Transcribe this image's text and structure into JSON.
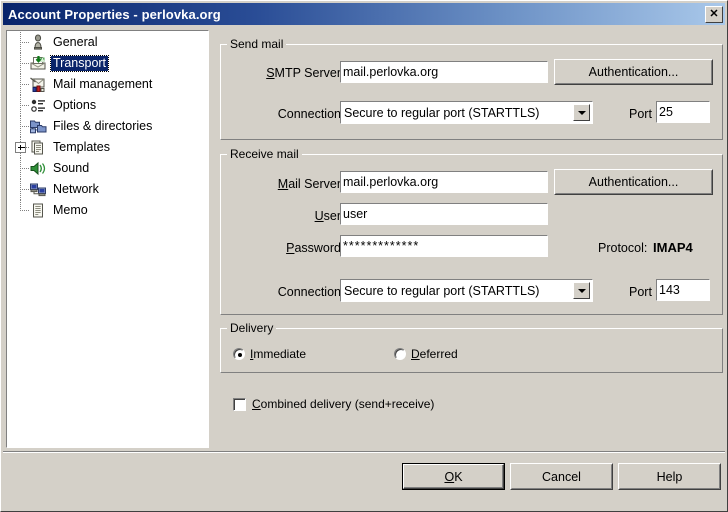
{
  "window": {
    "title": "Account Properties - perlovka.org",
    "close_label": "✕",
    "colors": {
      "face": "#d4d0c8",
      "title_left": "#08246b",
      "title_right": "#a9c8ea",
      "selection": "#0a246a"
    }
  },
  "sidebar": {
    "items": [
      {
        "label": "General",
        "icon": "person-icon",
        "selected": false,
        "expander": false
      },
      {
        "label": "Transport",
        "icon": "inbox-download-icon",
        "selected": true,
        "expander": false
      },
      {
        "label": "Mail management",
        "icon": "mail-tools-icon",
        "selected": false,
        "expander": false
      },
      {
        "label": "Options",
        "icon": "options-list-icon",
        "selected": false,
        "expander": false
      },
      {
        "label": "Files & directories",
        "icon": "folders-icon",
        "selected": false,
        "expander": false
      },
      {
        "label": "Templates",
        "icon": "documents-icon",
        "selected": false,
        "expander": true
      },
      {
        "label": "Sound",
        "icon": "speaker-icon",
        "selected": false,
        "expander": false
      },
      {
        "label": "Network",
        "icon": "network-computers-icon",
        "selected": false,
        "expander": false
      },
      {
        "label": "Memo",
        "icon": "note-icon",
        "selected": false,
        "expander": false
      }
    ]
  },
  "send_mail": {
    "group_title": "Send mail",
    "smtp_label_accel": "S",
    "smtp_label_rest": "MTP Server",
    "smtp_value": "mail.perlovka.org",
    "auth_button": "Authentication...",
    "connection_label": "Connection",
    "connection_value": "Secure to regular port (STARTTLS)",
    "port_label": "Port",
    "port_value": "25"
  },
  "receive_mail": {
    "group_title": "Receive mail",
    "mailserver_label_accel": "M",
    "mailserver_label_rest": "ail Server",
    "mailserver_value": "mail.perlovka.org",
    "auth_button": "Authentication...",
    "user_label_accel": "U",
    "user_label_rest": "ser",
    "user_value": "user",
    "password_label_accel": "P",
    "password_label_rest": "assword",
    "password_value": "*************",
    "protocol_label": "Protocol:",
    "protocol_value": "IMAP4",
    "connection_label": "Connection",
    "connection_value": "Secure to regular port (STARTTLS)",
    "port_label": "Port",
    "port_value": "143"
  },
  "delivery": {
    "group_title": "Delivery",
    "immediate_accel": "I",
    "immediate_rest": "mmediate",
    "immediate_selected": true,
    "deferred_accel": "D",
    "deferred_rest": "eferred",
    "deferred_selected": false,
    "combined_accel": "C",
    "combined_rest": "ombined delivery (send+receive)",
    "combined_checked": false
  },
  "footer": {
    "ok_accel": "O",
    "ok_rest": "K",
    "cancel_label": "Cancel",
    "help_label": "Help"
  }
}
